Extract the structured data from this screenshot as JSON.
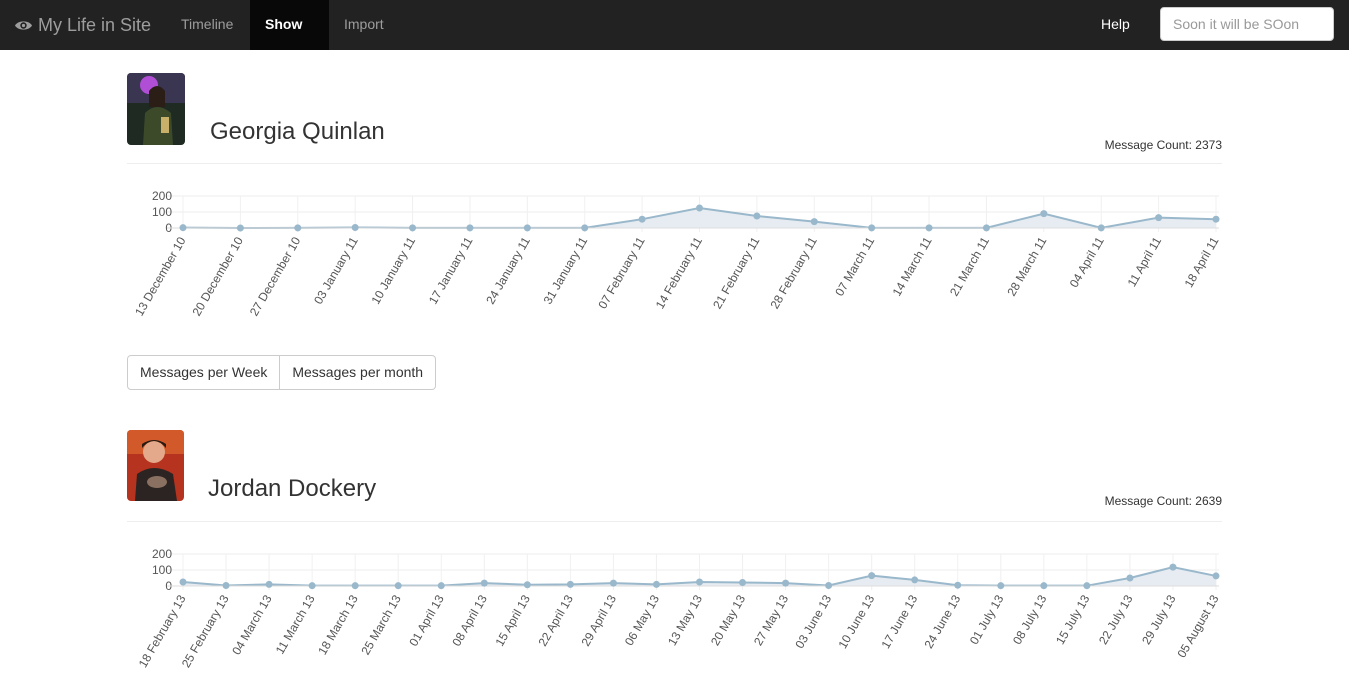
{
  "nav": {
    "brand": "My Life in Site",
    "links": [
      "Timeline",
      "Show",
      "Import"
    ],
    "help": "Help",
    "search_placeholder": "Soon it will be SOon",
    "brand_icon": "eye-icon"
  },
  "people": [
    {
      "name": "Georgia Quinlan",
      "message_count_label": "Message Count: 2373"
    },
    {
      "name": "Jordan Dockery",
      "message_count_label": "Message Count: 2639"
    }
  ],
  "toggle_buttons": [
    "Messages per Week",
    "Messages per month"
  ],
  "chart_data": [
    {
      "type": "area",
      "yticks": [
        0,
        100,
        200
      ],
      "ylim": [
        0,
        200
      ],
      "grid": true,
      "line_color": "#9ab8cb",
      "fill_color": "#e6ecf1",
      "categories": [
        "13 December 10",
        "20 December 10",
        "27 December 10",
        "03 January 11",
        "10 January 11",
        "17 January 11",
        "24 January 11",
        "31 January 11",
        "07 February 11",
        "14 February 11",
        "21 February 11",
        "28 February 11",
        "07 March 11",
        "14 March 11",
        "21 March 11",
        "28 March 11",
        "04 April 11",
        "11 April 11",
        "18 April 11"
      ],
      "values": [
        2,
        0,
        1,
        3,
        1,
        1,
        1,
        1,
        55,
        125,
        75,
        40,
        1,
        1,
        1,
        90,
        1,
        65,
        55
      ]
    },
    {
      "type": "area",
      "yticks": [
        0,
        100,
        200
      ],
      "ylim": [
        0,
        200
      ],
      "grid": true,
      "line_color": "#9ab8cb",
      "fill_color": "#e6ecf1",
      "categories": [
        "18 February 13",
        "25 February 13",
        "04 March 13",
        "11 March 13",
        "18 March 13",
        "25 March 13",
        "01 April 13",
        "08 April 13",
        "15 April 13",
        "22 April 13",
        "29 April 13",
        "06 May 13",
        "13 May 13",
        "20 May 13",
        "27 May 13",
        "03 June 13",
        "10 June 13",
        "17 June 13",
        "24 June 13",
        "01 July 13",
        "08 July 13",
        "15 July 13",
        "22 July 13",
        "29 July 13",
        "05 August 13"
      ],
      "values": [
        25,
        3,
        10,
        2,
        2,
        2,
        2,
        18,
        8,
        10,
        18,
        10,
        25,
        22,
        18,
        3,
        65,
        38,
        5,
        2,
        2,
        2,
        50,
        118,
        63
      ]
    }
  ]
}
